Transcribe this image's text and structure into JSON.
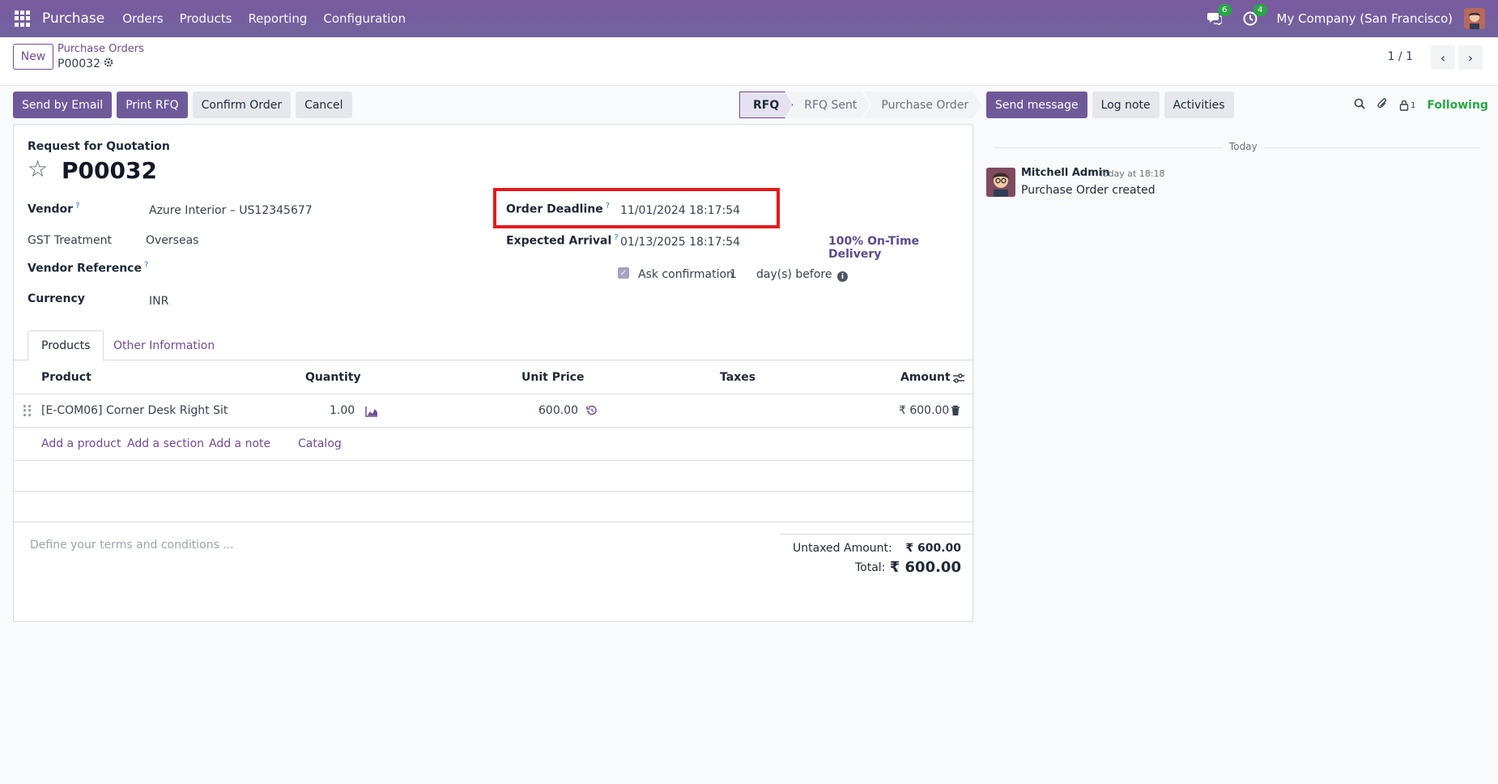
{
  "topbar": {
    "app_name": "Purchase",
    "menu": [
      "Orders",
      "Products",
      "Reporting",
      "Configuration"
    ],
    "messages_badge": "6",
    "activities_badge": "4",
    "company": "My Company (San Francisco)"
  },
  "control": {
    "new_label": "New",
    "breadcrumb_parent": "Purchase Orders",
    "breadcrumb_current": "P00032",
    "pager": "1 / 1"
  },
  "actions": {
    "send_by_email": "Send by Email",
    "print_rfq": "Print RFQ",
    "confirm_order": "Confirm Order",
    "cancel": "Cancel"
  },
  "statusbar": {
    "stages": [
      "RFQ",
      "RFQ Sent",
      "Purchase Order"
    ],
    "active": "RFQ"
  },
  "form": {
    "doc_type": "Request for Quotation",
    "name": "P00032",
    "vendor_label": "Vendor",
    "vendor_value": "Azure Interior – US12345677",
    "gst_label": "GST Treatment",
    "gst_value": "Overseas",
    "vendor_ref_label": "Vendor Reference",
    "currency_label": "Currency",
    "currency_value": "INR",
    "order_deadline_label": "Order Deadline",
    "order_deadline_value": "11/01/2024 18:17:54",
    "expected_arrival_label": "Expected Arrival",
    "expected_arrival_value": "01/13/2025 18:17:54",
    "on_time_delivery": "100% On-Time Delivery",
    "ask_confirmation_label": "Ask confirmation",
    "ask_confirmation_days": "1",
    "days_before": "day(s) before",
    "help_mark": "?"
  },
  "tabs": [
    "Products",
    "Other Information"
  ],
  "table": {
    "headers": [
      "Product",
      "Quantity",
      "Unit Price",
      "Taxes",
      "Amount"
    ],
    "rows": [
      {
        "product": "[E-COM06] Corner Desk Right Sit",
        "quantity": "1.00",
        "unit_price": "600.00",
        "taxes": "",
        "amount": "₹ 600.00"
      }
    ],
    "add_links": [
      "Add a product",
      "Add a section",
      "Add a note",
      "Catalog"
    ]
  },
  "terms_placeholder": "Define your terms and conditions ...",
  "totals": {
    "untaxed_label": "Untaxed Amount:",
    "untaxed_value": "₹ 600.00",
    "total_label": "Total:",
    "total_value": "₹ 600.00"
  },
  "chatter": {
    "send_message": "Send message",
    "log_note": "Log note",
    "activities": "Activities",
    "followers_count": "1",
    "following": "Following",
    "day_separator": "Today",
    "messages": [
      {
        "author": "Mitchell Admin",
        "time": "Today at 18:18",
        "body": "Purchase Order created"
      }
    ]
  }
}
